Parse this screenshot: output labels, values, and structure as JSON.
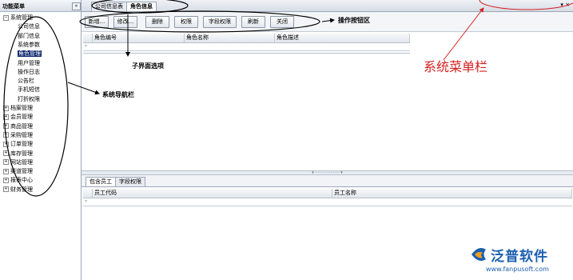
{
  "sidebar": {
    "title": "功能菜单",
    "collapse_glyph": "«",
    "items": [
      {
        "label": "系统管理",
        "root": true
      },
      {
        "label": "公司信息"
      },
      {
        "label": "部门信息"
      },
      {
        "label": "系统参数"
      },
      {
        "label": "角色管理",
        "selected": true
      },
      {
        "label": "用户管理"
      },
      {
        "label": "操作日志"
      },
      {
        "label": "公告栏"
      },
      {
        "label": "手机短信"
      },
      {
        "label": "打折权限"
      },
      {
        "label": "档案管理",
        "root": true
      },
      {
        "label": "会员管理",
        "root": true
      },
      {
        "label": "商品管理",
        "root": true
      },
      {
        "label": "采购管理",
        "root": true
      },
      {
        "label": "订单管理",
        "root": true
      },
      {
        "label": "库存管理",
        "root": true
      },
      {
        "label": "网站管理",
        "root": true
      },
      {
        "label": "渠道管理",
        "root": true
      },
      {
        "label": "报表中心",
        "root": true
      },
      {
        "label": "财务管理",
        "root": true
      }
    ]
  },
  "tabs": [
    "公司信息表",
    "角色信息"
  ],
  "window_controls": "▾ ×",
  "toolbar": {
    "buttons": [
      "新增...",
      "修改...",
      "删除",
      "权限",
      "字段权限",
      "刷新",
      "关闭"
    ]
  },
  "role_grid": {
    "columns": [
      "角色编号",
      "角色名称",
      "角色描述"
    ]
  },
  "splitter_glyph": "▾ ··················· ▾",
  "subtabs": [
    "包含员工",
    "字段权限"
  ],
  "employee_grid": {
    "columns": [
      "员工代码",
      "员工名称"
    ]
  },
  "annotations": {
    "toolbar_area": "操作按钮区",
    "sub_tabs": "子界面选项",
    "nav_bar": "系统导航栏",
    "menu_bar": "系统菜单栏"
  },
  "brand": {
    "name": "泛普软件",
    "url": "www.fanpusoft.com"
  },
  "colors": {
    "selection": "#0a246a",
    "annotation_red": "#d42020",
    "brand_blue": "#1d5fb0"
  }
}
